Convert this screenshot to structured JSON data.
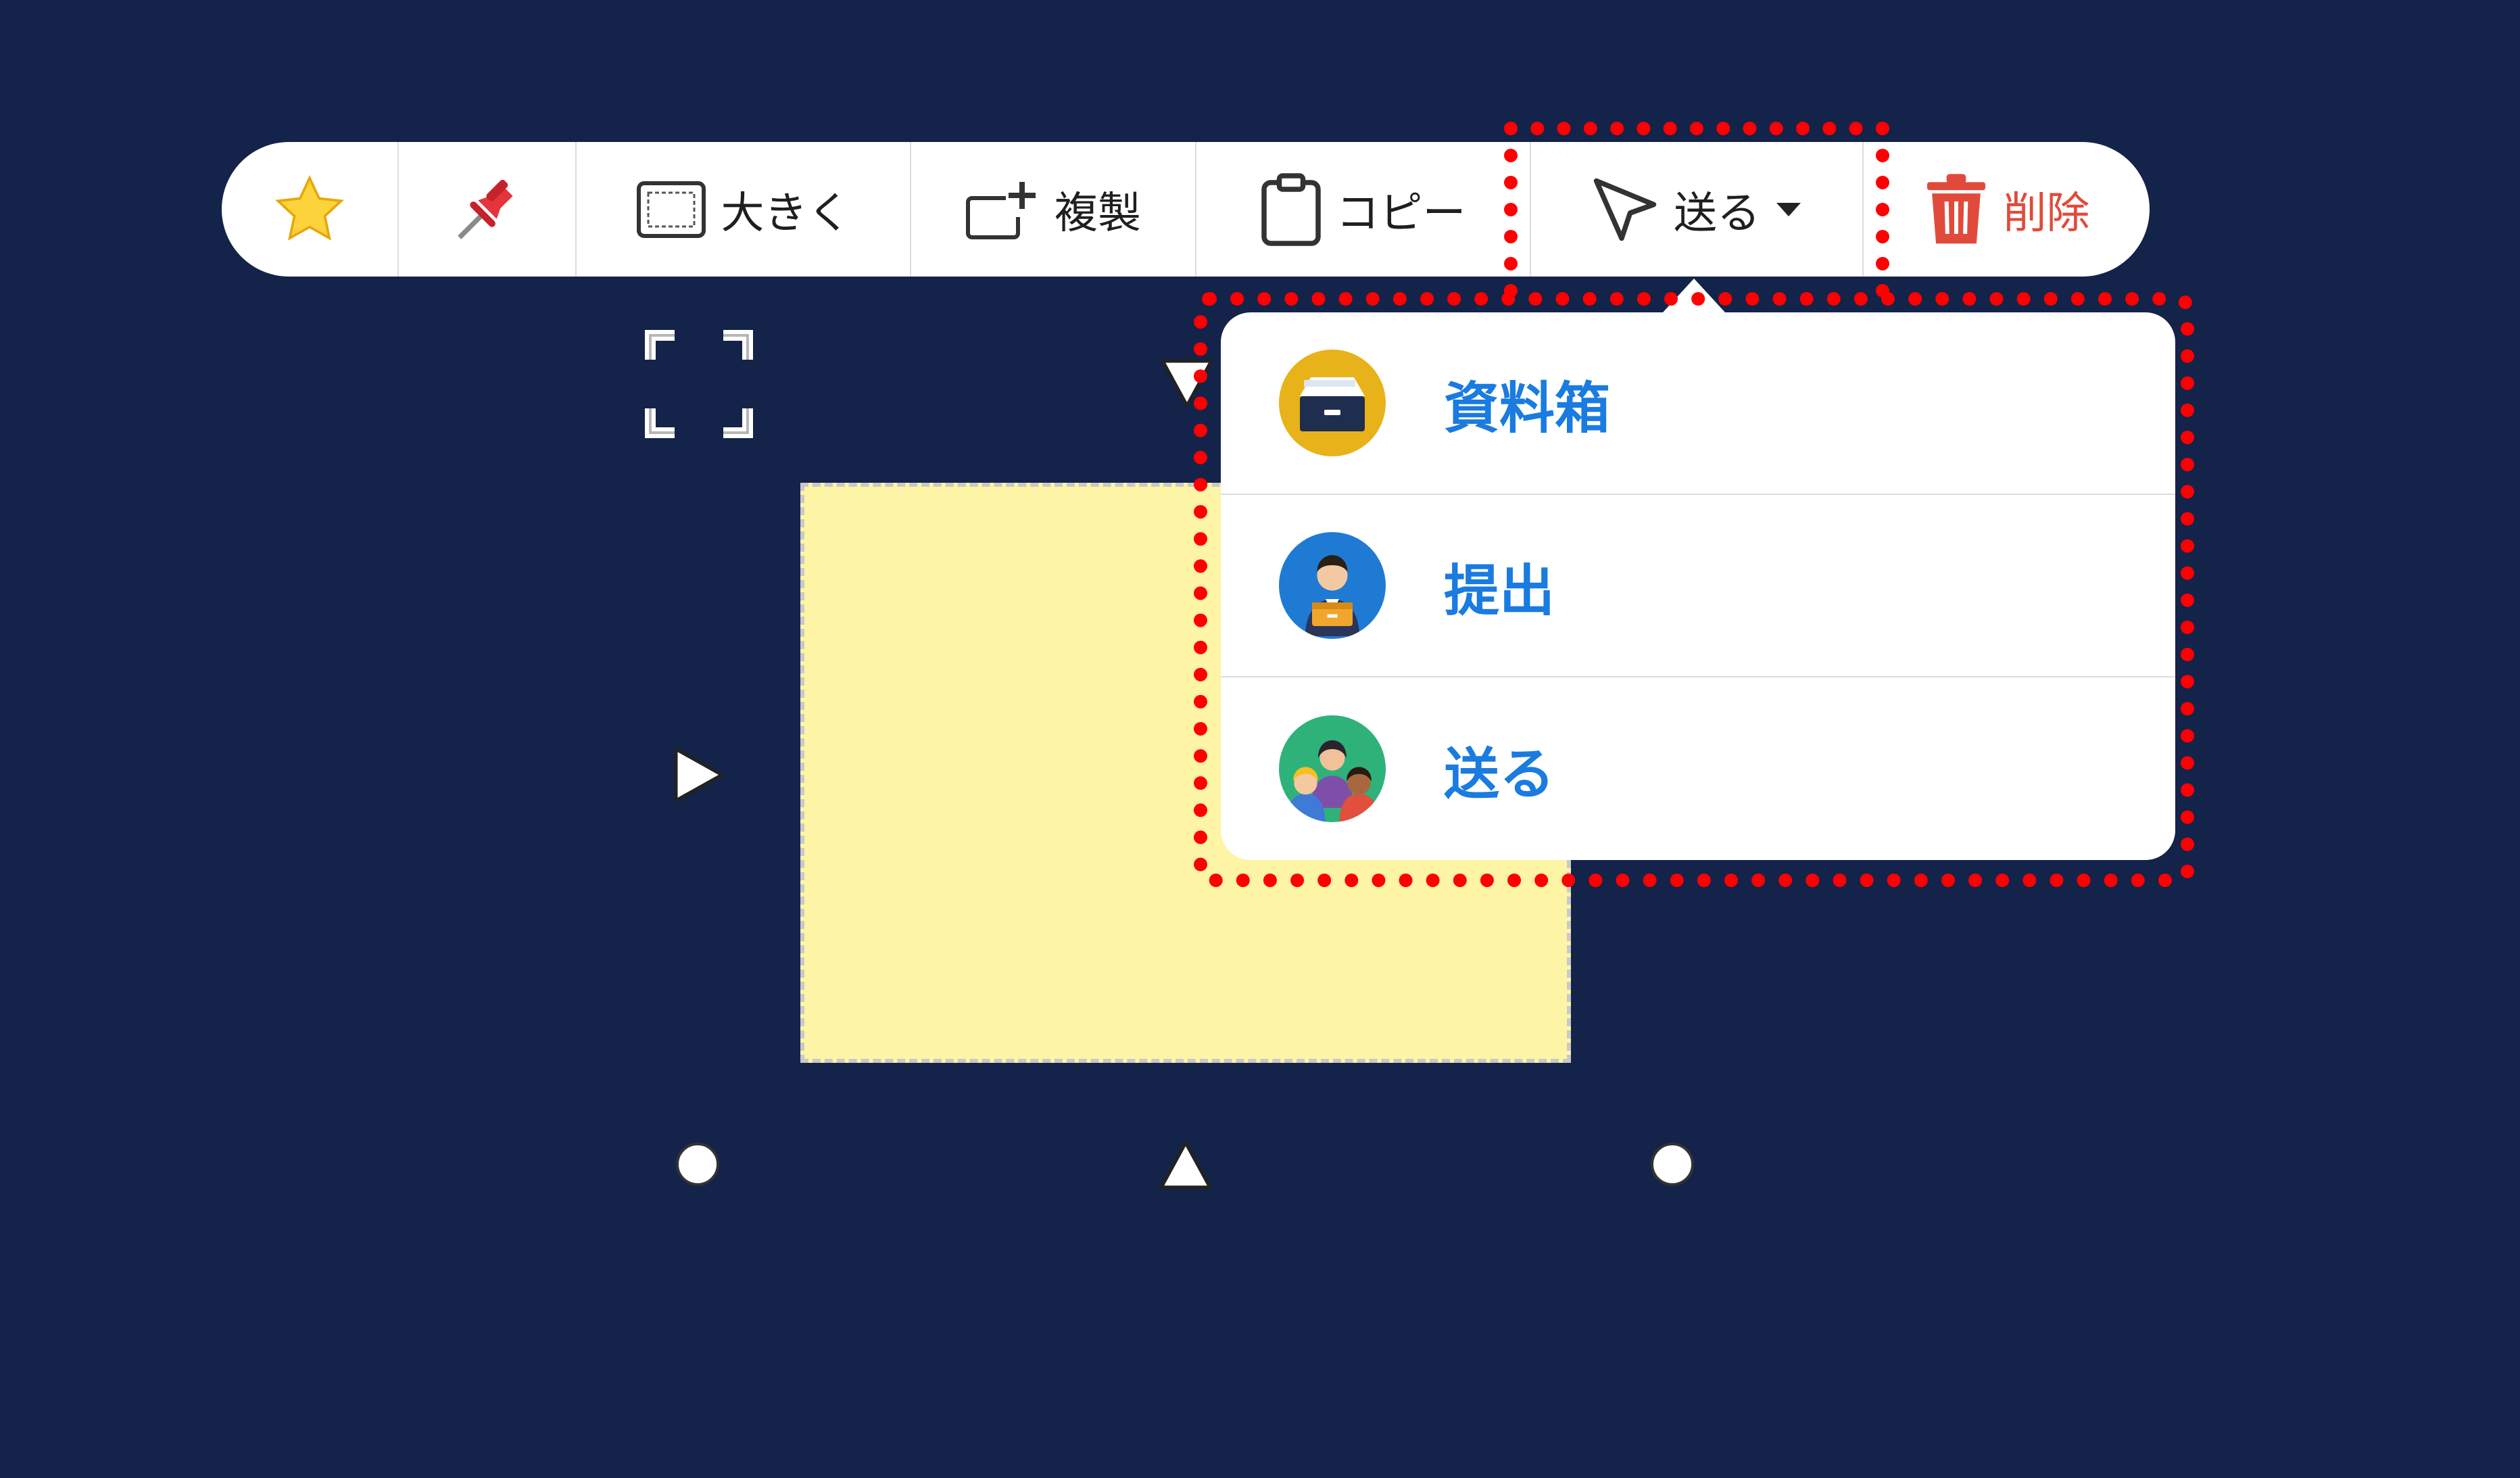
{
  "toolbar": {
    "favorite_icon": "star-icon",
    "pin_icon": "pushpin-icon",
    "enlarge_label": "大きく",
    "duplicate_label": "複製",
    "copy_label": "コピー",
    "send_label": "送る",
    "delete_label": "削除"
  },
  "send_menu": {
    "items": [
      {
        "label": "資料箱",
        "icon": "file-cabinet-icon",
        "icon_color": "#e8b21b"
      },
      {
        "label": "提出",
        "icon": "submit-person-icon",
        "icon_color": "#1f7ad4"
      },
      {
        "label": "送る",
        "icon": "group-people-icon",
        "icon_color": "#2fb27a"
      }
    ]
  },
  "colors": {
    "background": "#13234a",
    "accent": "#1a7be0",
    "danger": "#e14a3b",
    "sticky_note": "#fdf4a6",
    "highlight": "#ff0000"
  }
}
